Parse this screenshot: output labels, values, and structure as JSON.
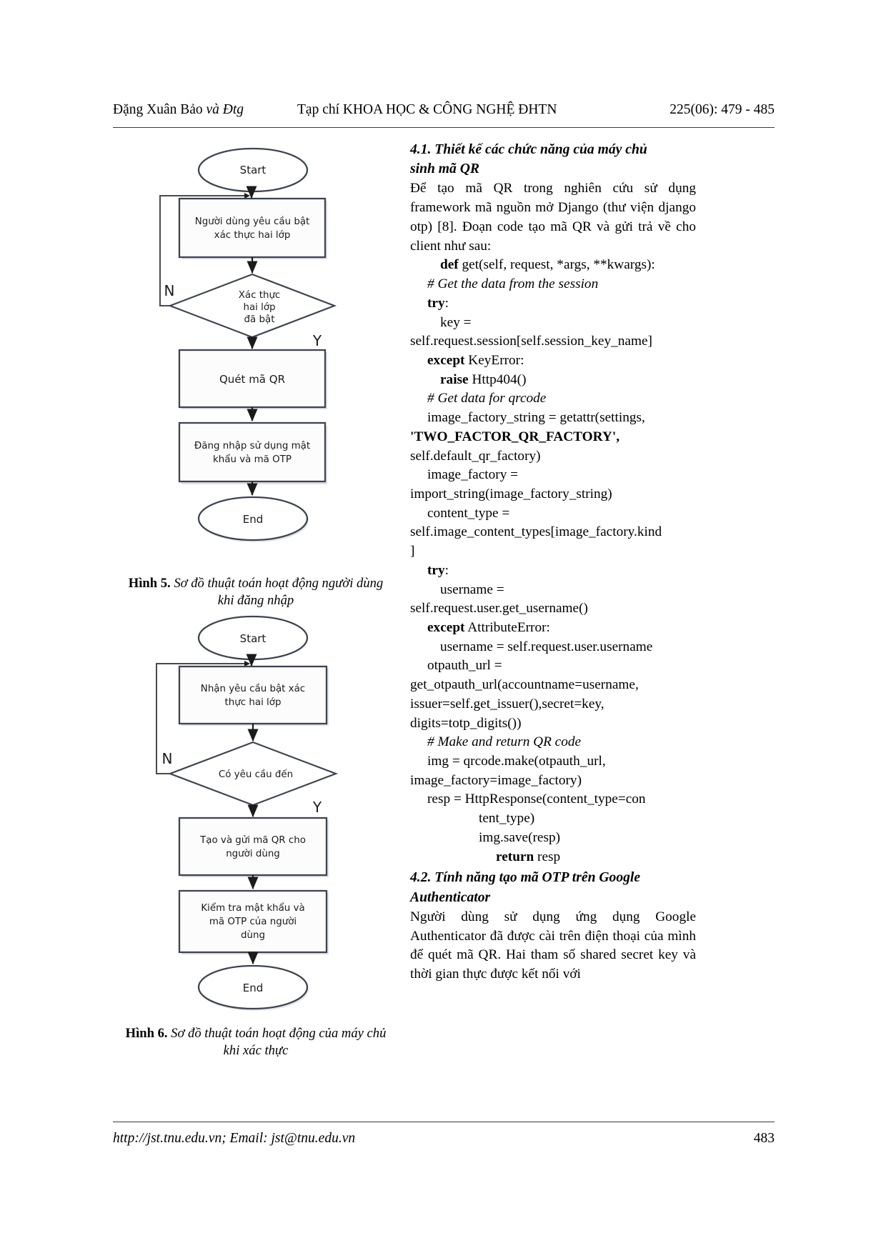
{
  "running_head": {
    "left_author": "Đặng Xuân Bảo",
    "left_author_suffix": "và Đtg",
    "center": "Tạp chí KHOA HỌC & CÔNG NGHỆ ĐHTN",
    "right": "225(06): 479 - 485"
  },
  "figures": [
    {
      "id": "figure-5",
      "caption_label": "Hình 5.",
      "caption_text": "Sơ đồ thuật toán hoạt động người dùng",
      "caption_text2": "khi đăng nhập",
      "nodes": {
        "start": "Start",
        "step1_line1": "Người dùng yêu cầu bật",
        "step1_line2": "xác thực hai lớp",
        "decision_line1": "Xác thực",
        "decision_line2": "hai lớp",
        "decision_line3": "đã bật",
        "branch_no": "N",
        "branch_yes": "Y",
        "step2": "Quét mã QR",
        "step3_line1": "Đăng nhập sử dụng mật",
        "step3_line2": "khẩu và mã OTP",
        "end": "End"
      }
    },
    {
      "id": "figure-6",
      "caption_label": "Hình 6.",
      "caption_text": "Sơ đồ thuật toán hoạt động của máy chủ",
      "caption_text2": "khi xác thực",
      "nodes": {
        "start": "Start",
        "step1_line1": "Nhận yêu cầu bật xác",
        "step1_line2": "thực hai lớp",
        "decision_line1": "Có yêu cầu đến",
        "branch_no": "N",
        "branch_yes": "Y",
        "step2_line1": "Tạo và gửi mã QR cho",
        "step2_line2": "người dùng",
        "step3_line1": "Kiểm tra mật khẩu và",
        "step3_line2": "mã OTP của người",
        "step3_line3": "dùng",
        "end": "End"
      }
    }
  ],
  "right_column": {
    "section_4_1_heading_line1": "4.1. Thiết kế các chức năng của máy chủ",
    "section_4_1_heading_line2": "sinh mã QR",
    "section_4_1_paragraph": "Để tạo mã QR trong nghiên cứu sử dụng framework mã nguồn mở Django (thư viện django otp) [8]. Đoạn code tạo mã QR và gửi trả về cho client như sau:",
    "code_lines": [
      {
        "indent": 2,
        "bold_head": "def",
        "rest": " get(self, request, *args, **kwargs):"
      },
      {
        "indent": 1,
        "comment": "# Get the data from the session"
      },
      {
        "indent": 1,
        "bold_head": "try",
        "rest": ":"
      },
      {
        "indent": 2,
        "rest": "key ="
      },
      {
        "indent": 0,
        "rest": "self.request.session[self.session_key_name]"
      },
      {
        "indent": 1,
        "bold_head": "except",
        "rest": " KeyError:"
      },
      {
        "indent": 2,
        "bold_head": "raise",
        "rest": " Http404()"
      },
      {
        "indent": 1,
        "comment": "# Get data for qrcode"
      },
      {
        "indent": 1,
        "rest": "image_factory_string = getattr(settings,"
      },
      {
        "indent": 0,
        "bold_all": "'TWO_FACTOR_QR_FACTORY',",
        "rest": ""
      },
      {
        "indent": 0,
        "rest": "self.default_qr_factory)"
      },
      {
        "indent": 1,
        "rest": "image_factory ="
      },
      {
        "indent": 0,
        "rest": "import_string(image_factory_string)"
      },
      {
        "indent": 1,
        "rest": "content_type ="
      },
      {
        "indent": 0,
        "rest": "self.image_content_types[image_factory.kind"
      },
      {
        "indent": 0,
        "rest": "]"
      },
      {
        "indent": 1,
        "bold_head": "try",
        "rest": ":"
      },
      {
        "indent": 2,
        "rest": "username ="
      },
      {
        "indent": 0,
        "rest": "self.request.user.get_username()"
      },
      {
        "indent": 1,
        "bold_head": "except",
        "rest": " AttributeError:"
      },
      {
        "indent": 2,
        "rest": "username = self.request.user.username"
      },
      {
        "indent": 1,
        "rest": "otpauth_url ="
      },
      {
        "indent": 0,
        "rest": "get_otpauth_url(accountname=username,"
      },
      {
        "indent": 0,
        "rest": "issuer=self.get_issuer(),secret=key,"
      },
      {
        "indent": 0,
        "rest": "digits=totp_digits())"
      },
      {
        "indent": 1,
        "comment": "# Make and return QR code"
      },
      {
        "indent": 1,
        "rest": "img = qrcode.make(otpauth_url,"
      },
      {
        "indent": 0,
        "rest": "image_factory=image_factory)"
      },
      {
        "indent": 1,
        "rest": "resp = HttpResponse(content_type=con"
      },
      {
        "indent": 4,
        "rest": "tent_type)"
      },
      {
        "indent": 4,
        "rest": "img.save(resp)"
      },
      {
        "indent": 5,
        "bold_head": "return",
        "rest": " resp"
      }
    ],
    "section_4_2_heading_line1": "4.2. Tính năng tạo mã OTP trên Google",
    "section_4_2_heading_line2": "Authenticator",
    "section_4_2_paragraph": "Người dùng sử dụng ứng dụng Google Authenticator đã được cài trên điện thoại của mình để quét mã QR. Hai tham số shared secret key và thời gian thực được kết nối với"
  },
  "footer": {
    "left": "http://jst.tnu.edu.vn; Email: jst@tnu.edu.vn",
    "page_number": "483"
  }
}
